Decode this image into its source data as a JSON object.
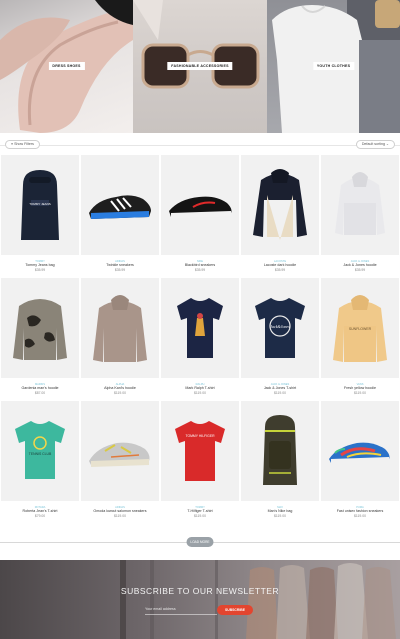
{
  "hero": {
    "banners": [
      {
        "label": "DRESS SHOES"
      },
      {
        "label": "FASHIONABLE ACCESSORIES"
      },
      {
        "label": "YOUTH CLOTHES"
      }
    ]
  },
  "filters": {
    "show_filters_label": "Show Filters",
    "sort_label": "Default sorting"
  },
  "products": [
    {
      "brand": "TOMMY",
      "name": "Tommy Jeans bag",
      "price": "$35.99"
    },
    {
      "brand": "ADIDAS",
      "name": "Twinkle sneakers",
      "price": "$35.99"
    },
    {
      "brand": "NIKE",
      "name": "Blackbird sneakers",
      "price": "$35.99"
    },
    {
      "brand": "LACOSTE",
      "name": "Lacoste dark hoodie",
      "price": "$35.99"
    },
    {
      "brand": "JACK & JONES",
      "name": "Jack & Jones hoodie",
      "price": "$35.99"
    },
    {
      "brand": "MARKIS",
      "name": "Gardenia man's hoodie",
      "price": "$87.00"
    },
    {
      "brand": "ALPHA",
      "name": "Alpha Kani's hoodie",
      "price": "$119.00"
    },
    {
      "brand": "RALPH",
      "name": "Mark Ralph T-shirt",
      "price": "$119.00"
    },
    {
      "brand": "JACK & JONES",
      "name": "Jack & Jones T-shirt",
      "price": "$119.00"
    },
    {
      "brand": "VANS",
      "name": "Fresh yellow hoodie",
      "price": "$119.00"
    },
    {
      "brand": "ROTARA",
      "name": "Roberta Jean's T-shirt",
      "price": "$79.00"
    },
    {
      "brand": "ADIDAS",
      "name": "Omoda lowcut salomon sneakers",
      "price": "$119.00"
    },
    {
      "brand": "TOMMY",
      "name": "T-Hilfiger T-shirt",
      "price": "$119.00"
    },
    {
      "brand": "MAX",
      "name": "Man's Nike bag",
      "price": "$119.00"
    },
    {
      "brand": "PUMA",
      "name": "Fast unisex fashion sneakers",
      "price": "$119.00"
    }
  ],
  "load_more_label": "LOAD MORE",
  "newsletter": {
    "title": "SUBSCRIBE TO OUR NEWSLETTER",
    "email_placeholder": "Your email address",
    "subscribe_label": "SUBSCRIBE"
  },
  "colors": {
    "subscribe_button": "#e3452f",
    "brand_text": "#7bc4d8",
    "load_more": "#9aa1a7"
  }
}
